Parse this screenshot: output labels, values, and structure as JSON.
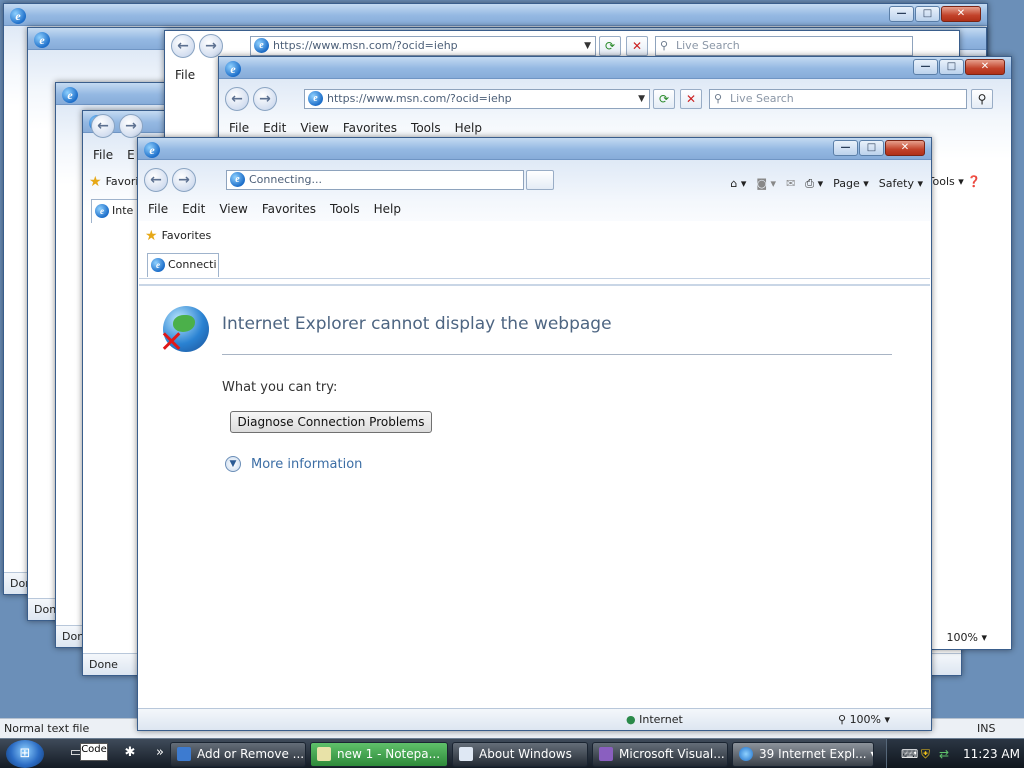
{
  "background_windows": {
    "address_url": "https://www.msn.com/?ocid=iehp",
    "search_placeholder": "Live Search",
    "menu": [
      "File",
      "Edit",
      "View",
      "Favorites",
      "Tools",
      "Help"
    ],
    "status_done": "Done",
    "zoom": "100%",
    "partial_address": "http",
    "partial_favorites": "Favori",
    "partial_tab": "Inte",
    "partial_menu_file": "File",
    "partial_menu_e": "E",
    "tools_label": "Tools"
  },
  "notepad_status": {
    "left": "Normal text file",
    "right": "INS"
  },
  "main_window": {
    "address_text": "Connecting...",
    "menu": [
      "File",
      "Edit",
      "View",
      "Favorites",
      "Tools",
      "Help"
    ],
    "favorites_label": "Favorites",
    "tab_label": "Connecti",
    "command_bar": {
      "page": "Page",
      "safety": "Safety"
    },
    "error": {
      "title": "Internet Explorer cannot display the webpage",
      "try_text": "What you can try:",
      "diagnose_button": "Diagnose Connection Problems",
      "more_info": "More information"
    },
    "status": {
      "zone": "Internet",
      "zoom": "100%"
    }
  },
  "taskbar": {
    "buttons": [
      {
        "label": "Add or Remove ...",
        "icon": "control-panel-icon"
      },
      {
        "label": "new 1 - Notepa...",
        "icon": "notepad-icon"
      },
      {
        "label": "About Windows",
        "icon": "window-icon"
      },
      {
        "label": "Microsoft Visual...",
        "icon": "visual-studio-icon"
      },
      {
        "label": "39 Internet Expl...",
        "icon": "ie-icon",
        "active": true
      }
    ],
    "clock": "11:23 AM",
    "ql_tooltip": "Code"
  }
}
